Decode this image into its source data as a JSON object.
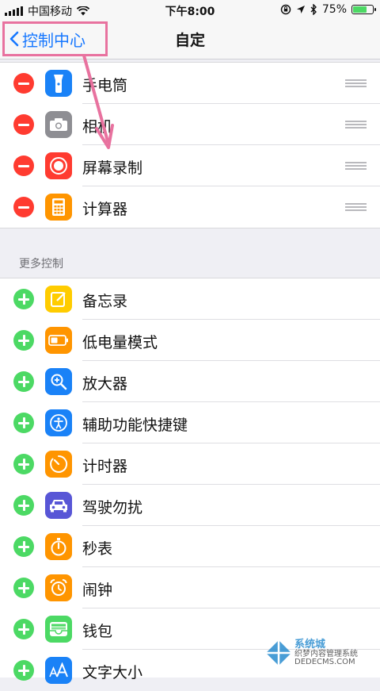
{
  "status_bar": {
    "carrier": "中国移动",
    "time": "下午8:00",
    "battery_percent": "75%",
    "battery_level": 0.75
  },
  "nav": {
    "back_label": "控制中心",
    "title": "自定"
  },
  "included_controls": [
    {
      "label": "手电筒",
      "icon": "flashlight-icon",
      "color": "#1a82f7"
    },
    {
      "label": "相机",
      "icon": "camera-icon",
      "color": "#8e8e93"
    },
    {
      "label": "屏幕录制",
      "icon": "screen-record-icon",
      "color": "#ff3b30"
    },
    {
      "label": "计算器",
      "icon": "calculator-icon",
      "color": "#ff9500"
    }
  ],
  "more_controls_header": "更多控制",
  "more_controls": [
    {
      "label": "备忘录",
      "icon": "notes-icon",
      "color": "#ffcc00"
    },
    {
      "label": "低电量模式",
      "icon": "low-power-icon",
      "color": "#ff9500"
    },
    {
      "label": "放大器",
      "icon": "magnifier-icon",
      "color": "#1a82f7"
    },
    {
      "label": "辅助功能快捷键",
      "icon": "accessibility-icon",
      "color": "#1a82f7"
    },
    {
      "label": "计时器",
      "icon": "timer-icon",
      "color": "#ff9500"
    },
    {
      "label": "驾驶勿扰",
      "icon": "car-icon",
      "color": "#5856d6"
    },
    {
      "label": "秒表",
      "icon": "stopwatch-icon",
      "color": "#ff9500"
    },
    {
      "label": "闹钟",
      "icon": "alarm-icon",
      "color": "#ff9500"
    },
    {
      "label": "钱包",
      "icon": "wallet-icon",
      "color": "#4cd964"
    },
    {
      "label": "文字大小",
      "icon": "text-size-icon",
      "color": "#1a82f7"
    }
  ],
  "watermark": {
    "line1": "系统城",
    "line2": "织梦内容管理系统",
    "line3": "DEDECMS.COM"
  }
}
